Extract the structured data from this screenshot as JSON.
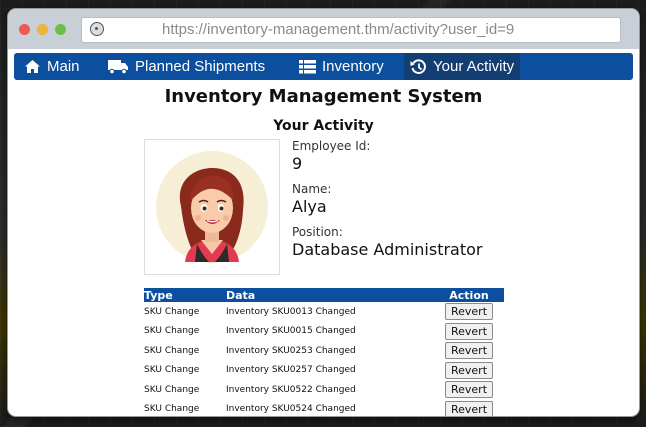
{
  "browser": {
    "url": "https://inventory-management.thm/activity?user_id=9"
  },
  "nav": {
    "items": [
      {
        "label": "Main",
        "icon": "home-icon"
      },
      {
        "label": "Planned Shipments",
        "icon": "truck-icon"
      },
      {
        "label": "Inventory",
        "icon": "list-icon"
      },
      {
        "label": "Your Activity",
        "icon": "history-icon",
        "active": true
      }
    ],
    "accent": "#0b4f9e"
  },
  "app_title": "Inventory Management System",
  "section_title": "Your Activity",
  "profile": {
    "employee_id_label": "Employee Id:",
    "employee_id": "9",
    "name_label": "Name:",
    "name": "Alya",
    "position_label": "Position:",
    "position": "Database Administrator"
  },
  "activity_table": {
    "headers": [
      "Type",
      "Data",
      "Action"
    ],
    "rows": [
      {
        "type": "SKU Change",
        "data": "Inventory SKU0013 Changed",
        "action": "Revert"
      },
      {
        "type": "SKU Change",
        "data": "Inventory SKU0015 Changed",
        "action": "Revert"
      },
      {
        "type": "SKU Change",
        "data": "Inventory SKU0253 Changed",
        "action": "Revert"
      },
      {
        "type": "SKU Change",
        "data": "Inventory SKU0257 Changed",
        "action": "Revert"
      },
      {
        "type": "SKU Change",
        "data": "Inventory SKU0522 Changed",
        "action": "Revert"
      },
      {
        "type": "SKU Change",
        "data": "Inventory SKU0524 Changed",
        "action": "Revert"
      }
    ]
  }
}
